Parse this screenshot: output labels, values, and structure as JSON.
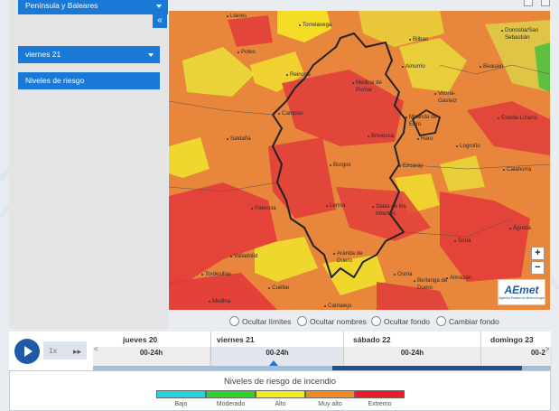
{
  "panel": {
    "region_label": "Península y Baleares",
    "day_label": "viernes 21",
    "layer_label": "Niveles de riesgo",
    "collapse_glyph": "«"
  },
  "map": {
    "places": [
      "Llanes",
      "Torrelavega",
      "Bilbao",
      "Donostia/San Sebastián",
      "Potes",
      "Reinosa",
      "Amurrio",
      "Beasain",
      "Medina de Pomar",
      "Vitoria-Gasteiz",
      "Campoo",
      "Miranda de Ebro",
      "Estella-Lizarra",
      "Saldaña",
      "Briviesca",
      "Haro",
      "Logroño",
      "Ezcaray",
      "Calahorra",
      "Burgos",
      "Palencia",
      "Lerma",
      "Salas de los Infantes",
      "Soria",
      "Valladolid",
      "Aranda de Duero",
      "Ágreda",
      "Tordesillas",
      "Osma",
      "Berlanga de Duero",
      "Almazán",
      "Cuéllar",
      "Medina",
      "Cantalejo"
    ],
    "zoom_in": "+",
    "zoom_out": "−",
    "logo_text": "AEmet",
    "logo_sub": "Agencia Estatal de Meteorología"
  },
  "options": {
    "hide_limits": "Ocultar límites",
    "hide_names": "Ocultar nombres",
    "hide_background": "Ocultar fondo",
    "change_background": "Cambiar fondo"
  },
  "player": {
    "speed": "1x",
    "ff_glyph": "▸▸",
    "prev_glyph": "<",
    "next_glyph": ">"
  },
  "timeline": {
    "days": [
      {
        "name": "jueves 20",
        "slot": "00-24h"
      },
      {
        "name": "viernes 21",
        "slot": "00-24h"
      },
      {
        "name": "sábado 22",
        "slot": "00-24h"
      },
      {
        "name": "domingo 23",
        "slot": "00-2"
      }
    ],
    "selected_index": 1
  },
  "legend": {
    "title": "Niveles de riesgo de incendio",
    "levels": [
      {
        "label": "Bajo",
        "color": "#22d6d9"
      },
      {
        "label": "Moderado",
        "color": "#2fd32f"
      },
      {
        "label": "Alto",
        "color": "#f4ec23"
      },
      {
        "label": "Muy alto",
        "color": "#f08b22"
      },
      {
        "label": "Extremo",
        "color": "#ec1c24"
      }
    ]
  }
}
